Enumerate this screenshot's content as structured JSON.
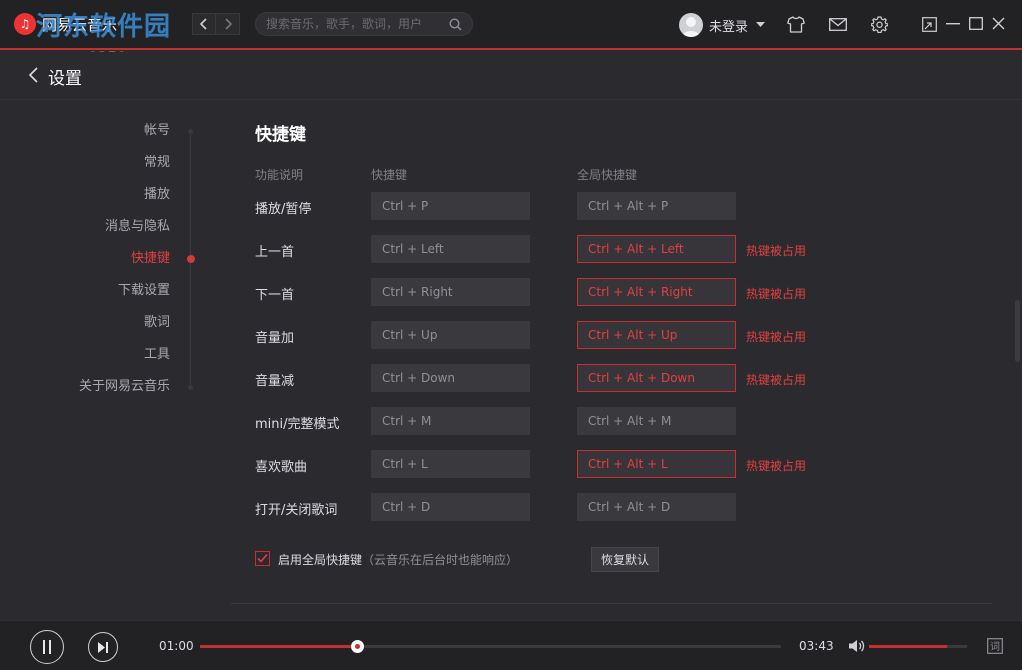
{
  "app": {
    "name": "网易云音乐"
  },
  "watermark": {
    "text": "河东软件园",
    "url": "www.pc0359.cn"
  },
  "search": {
    "placeholder": "搜索音乐，歌手，歌词，用户"
  },
  "user": {
    "name": "未登录"
  },
  "header": {
    "title": "设置"
  },
  "sidebar": {
    "items": [
      {
        "label": "帐号",
        "active": false
      },
      {
        "label": "常规",
        "active": false
      },
      {
        "label": "播放",
        "active": false
      },
      {
        "label": "消息与隐私",
        "active": false
      },
      {
        "label": "快捷键",
        "active": true
      },
      {
        "label": "下载设置",
        "active": false
      },
      {
        "label": "歌词",
        "active": false
      },
      {
        "label": "工具",
        "active": false
      },
      {
        "label": "关于网易云音乐",
        "active": false
      }
    ]
  },
  "shortcuts": {
    "title": "快捷键",
    "col_function": "功能说明",
    "col_shortcut": "快捷键",
    "col_global": "全局快捷键",
    "conflict_label": "热键被占用",
    "rows": [
      {
        "label": "播放/暂停",
        "local": "Ctrl + P",
        "global": "Ctrl + Alt + P",
        "conflict": false
      },
      {
        "label": "上一首",
        "local": "Ctrl + Left",
        "global": "Ctrl + Alt + Left",
        "conflict": true
      },
      {
        "label": "下一首",
        "local": "Ctrl + Right",
        "global": "Ctrl + Alt + Right",
        "conflict": true
      },
      {
        "label": "音量加",
        "local": "Ctrl + Up",
        "global": "Ctrl + Alt + Up",
        "conflict": true
      },
      {
        "label": "音量减",
        "local": "Ctrl + Down",
        "global": "Ctrl + Alt + Down",
        "conflict": true
      },
      {
        "label": "mini/完整模式",
        "local": "Ctrl + M",
        "global": "Ctrl + Alt + M",
        "conflict": false
      },
      {
        "label": "喜欢歌曲",
        "local": "Ctrl + L",
        "global": "Ctrl + Alt + L",
        "conflict": true
      },
      {
        "label": "打开/关闭歌词",
        "local": "Ctrl + D",
        "global": "Ctrl + Alt + D",
        "conflict": false
      }
    ],
    "enable_global_label": "启用全局快捷键",
    "enable_global_hint": "（云音乐在后台时也能响应）",
    "enable_global_checked": true,
    "restore_label": "恢复默认"
  },
  "player": {
    "current_time": "01:00",
    "total_time": "03:43",
    "progress_fraction": 0.27,
    "volume_fraction": 0.8,
    "lyrics_label": "词"
  },
  "colors": {
    "accent": "#c62f2f",
    "background": "#2b2b2f",
    "titlebar": "#222225"
  }
}
